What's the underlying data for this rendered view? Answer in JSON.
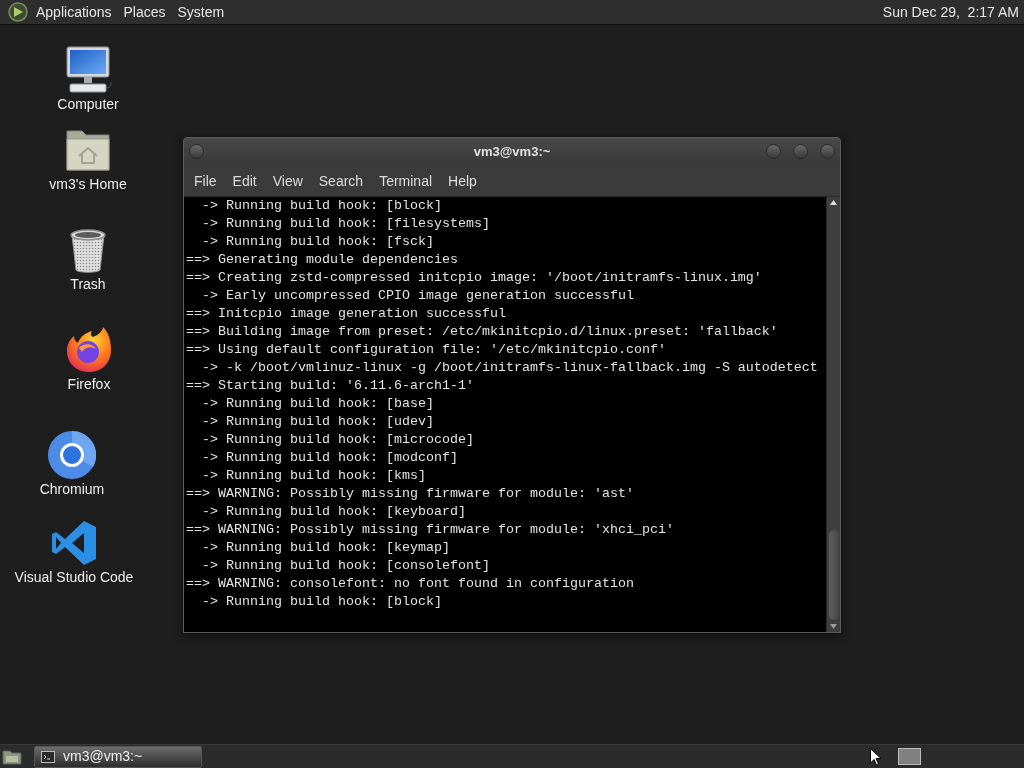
{
  "top_panel": {
    "menus": [
      {
        "label": "Applications"
      },
      {
        "label": "Places"
      },
      {
        "label": "System"
      }
    ],
    "clock": "Sun Dec 29,  2:17 AM"
  },
  "desktop_icons": [
    {
      "kind": "computer",
      "label": "Computer"
    },
    {
      "kind": "home",
      "label": "vm3's Home"
    },
    {
      "kind": "trash",
      "label": "Trash"
    },
    {
      "kind": "firefox",
      "label": "Firefox"
    },
    {
      "kind": "chromium",
      "label": "Chromium"
    },
    {
      "kind": "vscode",
      "label": "Visual Studio Code"
    }
  ],
  "terminal_window": {
    "title": "vm3@vm3:~",
    "menu": [
      "File",
      "Edit",
      "View",
      "Search",
      "Terminal",
      "Help"
    ],
    "lines": [
      "  -> Running build hook: [block]",
      "  -> Running build hook: [filesystems]",
      "  -> Running build hook: [fsck]",
      "==> Generating module dependencies",
      "==> Creating zstd-compressed initcpio image: '/boot/initramfs-linux.img'",
      "  -> Early uncompressed CPIO image generation successful",
      "==> Initcpio image generation successful",
      "==> Building image from preset: /etc/mkinitcpio.d/linux.preset: 'fallback'",
      "==> Using default configuration file: '/etc/mkinitcpio.conf'",
      "  -> -k /boot/vmlinuz-linux -g /boot/initramfs-linux-fallback.img -S autodetect",
      "==> Starting build: '6.11.6-arch1-1'",
      "  -> Running build hook: [base]",
      "  -> Running build hook: [udev]",
      "  -> Running build hook: [microcode]",
      "  -> Running build hook: [modconf]",
      "  -> Running build hook: [kms]",
      "==> WARNING: Possibly missing firmware for module: 'ast'",
      "  -> Running build hook: [keyboard]",
      "==> WARNING: Possibly missing firmware for module: 'xhci_pci'",
      "  -> Running build hook: [keymap]",
      "  -> Running build hook: [consolefont]",
      "==> WARNING: consolefont: no font found in configuration",
      "  -> Running build hook: [block]"
    ]
  },
  "bottom_panel": {
    "tasks": [
      {
        "label": "vm3@vm3:~",
        "selected": true
      }
    ]
  }
}
